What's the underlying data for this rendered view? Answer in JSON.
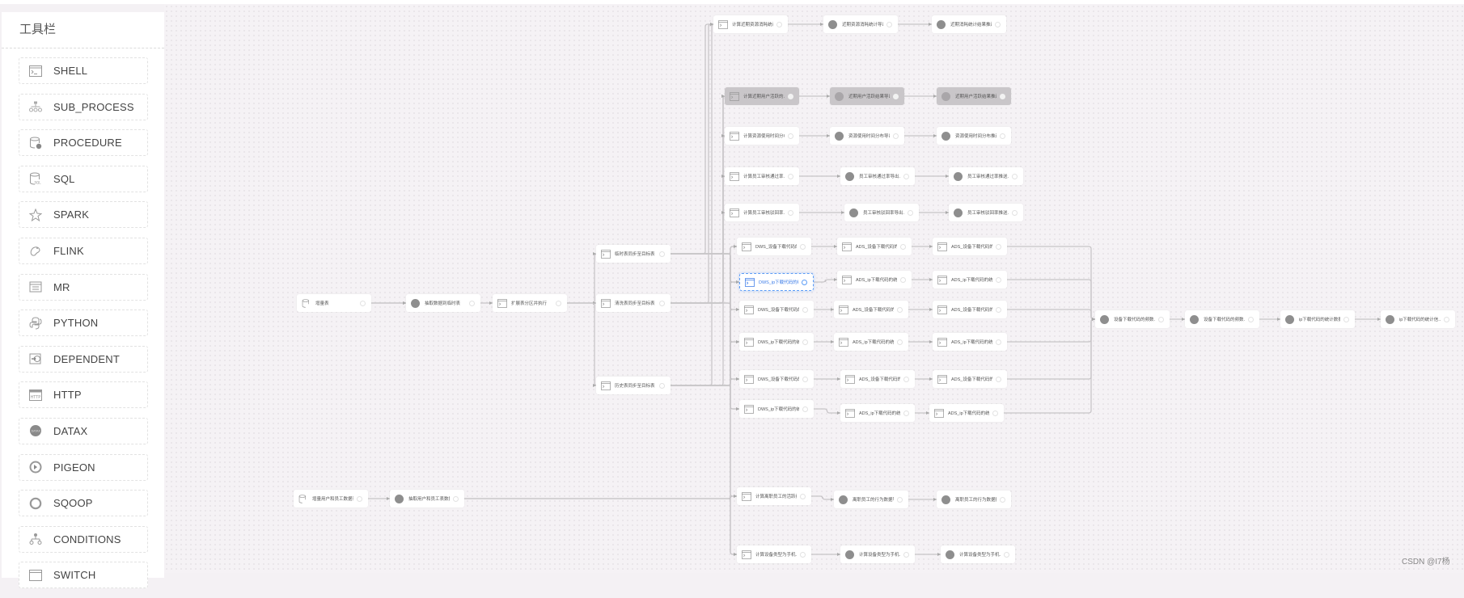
{
  "app": {
    "toolbar_title": "工具栏",
    "watermark": "CSDN @I7杨"
  },
  "sidebar": {
    "items": [
      {
        "label": "SHELL",
        "icon": "shell-icon"
      },
      {
        "label": "SUB_PROCESS",
        "icon": "sub-process-icon"
      },
      {
        "label": "PROCEDURE",
        "icon": "procedure-icon"
      },
      {
        "label": "SQL",
        "icon": "sql-icon"
      },
      {
        "label": "SPARK",
        "icon": "spark-icon"
      },
      {
        "label": "FLINK",
        "icon": "flink-icon"
      },
      {
        "label": "MR",
        "icon": "mr-icon"
      },
      {
        "label": "PYTHON",
        "icon": "python-icon"
      },
      {
        "label": "DEPENDENT",
        "icon": "dependent-icon"
      },
      {
        "label": "HTTP",
        "icon": "http-icon"
      },
      {
        "label": "DATAX",
        "icon": "datax-icon"
      },
      {
        "label": "PIGEON",
        "icon": "pigeon-icon"
      },
      {
        "label": "SQOOP",
        "icon": "sqoop-icon"
      },
      {
        "label": "CONDITIONS",
        "icon": "conditions-icon"
      },
      {
        "label": "SWITCH",
        "icon": "switch-icon"
      }
    ]
  },
  "colors": {
    "canvas_bg": "#f5f2f5",
    "node_bg": "#ffffff",
    "node_disabled_bg": "#c9c6c9",
    "selected_accent": "#5b9cf6",
    "edge": "#c8c5c8"
  },
  "dag": {
    "nodes": [
      {
        "id": "n1",
        "type": "sql",
        "label": "增量表",
        "state": "normal"
      },
      {
        "id": "n2",
        "type": "datax",
        "label": "抽取数据到临时表",
        "state": "normal"
      },
      {
        "id": "n3",
        "type": "shell",
        "label": "扩展表分区并执行",
        "state": "normal"
      },
      {
        "id": "m1",
        "type": "shell",
        "label": "临时表同步至目标表",
        "state": "normal"
      },
      {
        "id": "m2",
        "type": "shell",
        "label": "清洗表同步至目标表",
        "state": "normal"
      },
      {
        "id": "m3",
        "type": "shell",
        "label": "历史表同步至目标表",
        "state": "normal"
      },
      {
        "id": "r1a",
        "type": "shell",
        "label": "计算近期资源消耗统计...",
        "state": "normal"
      },
      {
        "id": "r1b",
        "type": "datax",
        "label": "近期资源消耗统计导出...",
        "state": "normal"
      },
      {
        "id": "r1c",
        "type": "datax",
        "label": "近期消耗统计结果推送...",
        "state": "normal"
      },
      {
        "id": "r2a",
        "type": "shell",
        "label": "计算近期用户活跃的...",
        "state": "disabled"
      },
      {
        "id": "r2b",
        "type": "datax",
        "label": "近期用户活跃结果导出...",
        "state": "disabled"
      },
      {
        "id": "r2c",
        "type": "datax",
        "label": "近期用户活跃结果推送...",
        "state": "disabled"
      },
      {
        "id": "r3a",
        "type": "shell",
        "label": "计算资源使用时间分布...",
        "state": "normal"
      },
      {
        "id": "r3b",
        "type": "datax",
        "label": "资源使用时间分布导出...",
        "state": "normal"
      },
      {
        "id": "r3c",
        "type": "datax",
        "label": "资源使用时间分布推送...",
        "state": "normal"
      },
      {
        "id": "r4a",
        "type": "shell",
        "label": "计算员工审核通过率...",
        "state": "normal"
      },
      {
        "id": "r4b",
        "type": "datax",
        "label": "员工审核通过率导出...",
        "state": "normal"
      },
      {
        "id": "r4c",
        "type": "datax",
        "label": "员工审核通过率推送...",
        "state": "normal"
      },
      {
        "id": "r5a",
        "type": "shell",
        "label": "计算员工审核驳回率...",
        "state": "normal"
      },
      {
        "id": "r5b",
        "type": "datax",
        "label": "员工审核驳回率导出...",
        "state": "normal"
      },
      {
        "id": "r5c",
        "type": "datax",
        "label": "员工审核驳回率推送...",
        "state": "normal"
      },
      {
        "id": "d1a",
        "type": "shell",
        "label": "DWS_设备下载代码的频...",
        "state": "normal"
      },
      {
        "id": "d1b",
        "type": "shell",
        "label": "ADS_设备下载代码的频...",
        "state": "normal"
      },
      {
        "id": "d1c",
        "type": "shell",
        "label": "ADS_设备下载代码的频...",
        "state": "normal"
      },
      {
        "id": "d2a",
        "type": "shell",
        "label": "DWS_ip下载代码的统计...",
        "state": "selected"
      },
      {
        "id": "d2b",
        "type": "shell",
        "label": "ADS_ip下载代码的统计...",
        "state": "normal"
      },
      {
        "id": "d2c",
        "type": "shell",
        "label": "ADS_ip下载代码的统计...",
        "state": "normal"
      },
      {
        "id": "d3a",
        "type": "shell",
        "label": "DWS_设备下载代码的频...",
        "state": "normal"
      },
      {
        "id": "d3b",
        "type": "shell",
        "label": "ADS_设备下载代码的频...",
        "state": "normal"
      },
      {
        "id": "d3c",
        "type": "shell",
        "label": "ADS_设备下载代码的频...",
        "state": "normal"
      },
      {
        "id": "d4a",
        "type": "shell",
        "label": "DWS_ip下载代码的统计...",
        "state": "normal"
      },
      {
        "id": "d4b",
        "type": "shell",
        "label": "ADS_ip下载代码的统计...",
        "state": "normal"
      },
      {
        "id": "d4c",
        "type": "shell",
        "label": "ADS_ip下载代码的统计...",
        "state": "normal"
      },
      {
        "id": "d5a",
        "type": "shell",
        "label": "DWS_设备下载代码的频...",
        "state": "normal"
      },
      {
        "id": "d5b",
        "type": "shell",
        "label": "ADS_设备下载代码的频...",
        "state": "normal"
      },
      {
        "id": "d5c",
        "type": "shell",
        "label": "ADS_设备下载代码的频...",
        "state": "normal"
      },
      {
        "id": "d6a",
        "type": "shell",
        "label": "DWS_ip下载代码的统计...",
        "state": "normal"
      },
      {
        "id": "d6b",
        "type": "shell",
        "label": "ADS_ip下载代码的统计...",
        "state": "normal"
      },
      {
        "id": "d6c",
        "type": "shell",
        "label": "ADS_ip下载代码的统计...",
        "state": "normal"
      },
      {
        "id": "j1",
        "type": "datax",
        "label": "设备下载代码的频数...",
        "state": "normal"
      },
      {
        "id": "j2",
        "type": "datax",
        "label": "设备下载代码的频数...",
        "state": "normal"
      },
      {
        "id": "j3",
        "type": "datax",
        "label": "ip下载代码的统计数据...",
        "state": "normal"
      },
      {
        "id": "j4",
        "type": "datax",
        "label": "ip下载代码的统计信...",
        "state": "normal"
      },
      {
        "id": "b1",
        "type": "sql",
        "label": "增量用户和员工数据表",
        "state": "normal"
      },
      {
        "id": "b2",
        "type": "datax",
        "label": "抽取用户和员工表数据",
        "state": "normal"
      },
      {
        "id": "b3a",
        "type": "shell",
        "label": "计算离职员工的活跃行...",
        "state": "normal"
      },
      {
        "id": "b3b",
        "type": "datax",
        "label": "离职员工的行为数据导...",
        "state": "normal"
      },
      {
        "id": "b3c",
        "type": "datax",
        "label": "离职员工的行为数据推...",
        "state": "normal"
      },
      {
        "id": "b4a",
        "type": "shell",
        "label": "计算设备类型为手机...",
        "state": "normal"
      },
      {
        "id": "b4b",
        "type": "datax",
        "label": "计算设备类型为手机...",
        "state": "normal"
      },
      {
        "id": "b4c",
        "type": "datax",
        "label": "计算设备类型为手机...",
        "state": "normal"
      }
    ]
  }
}
